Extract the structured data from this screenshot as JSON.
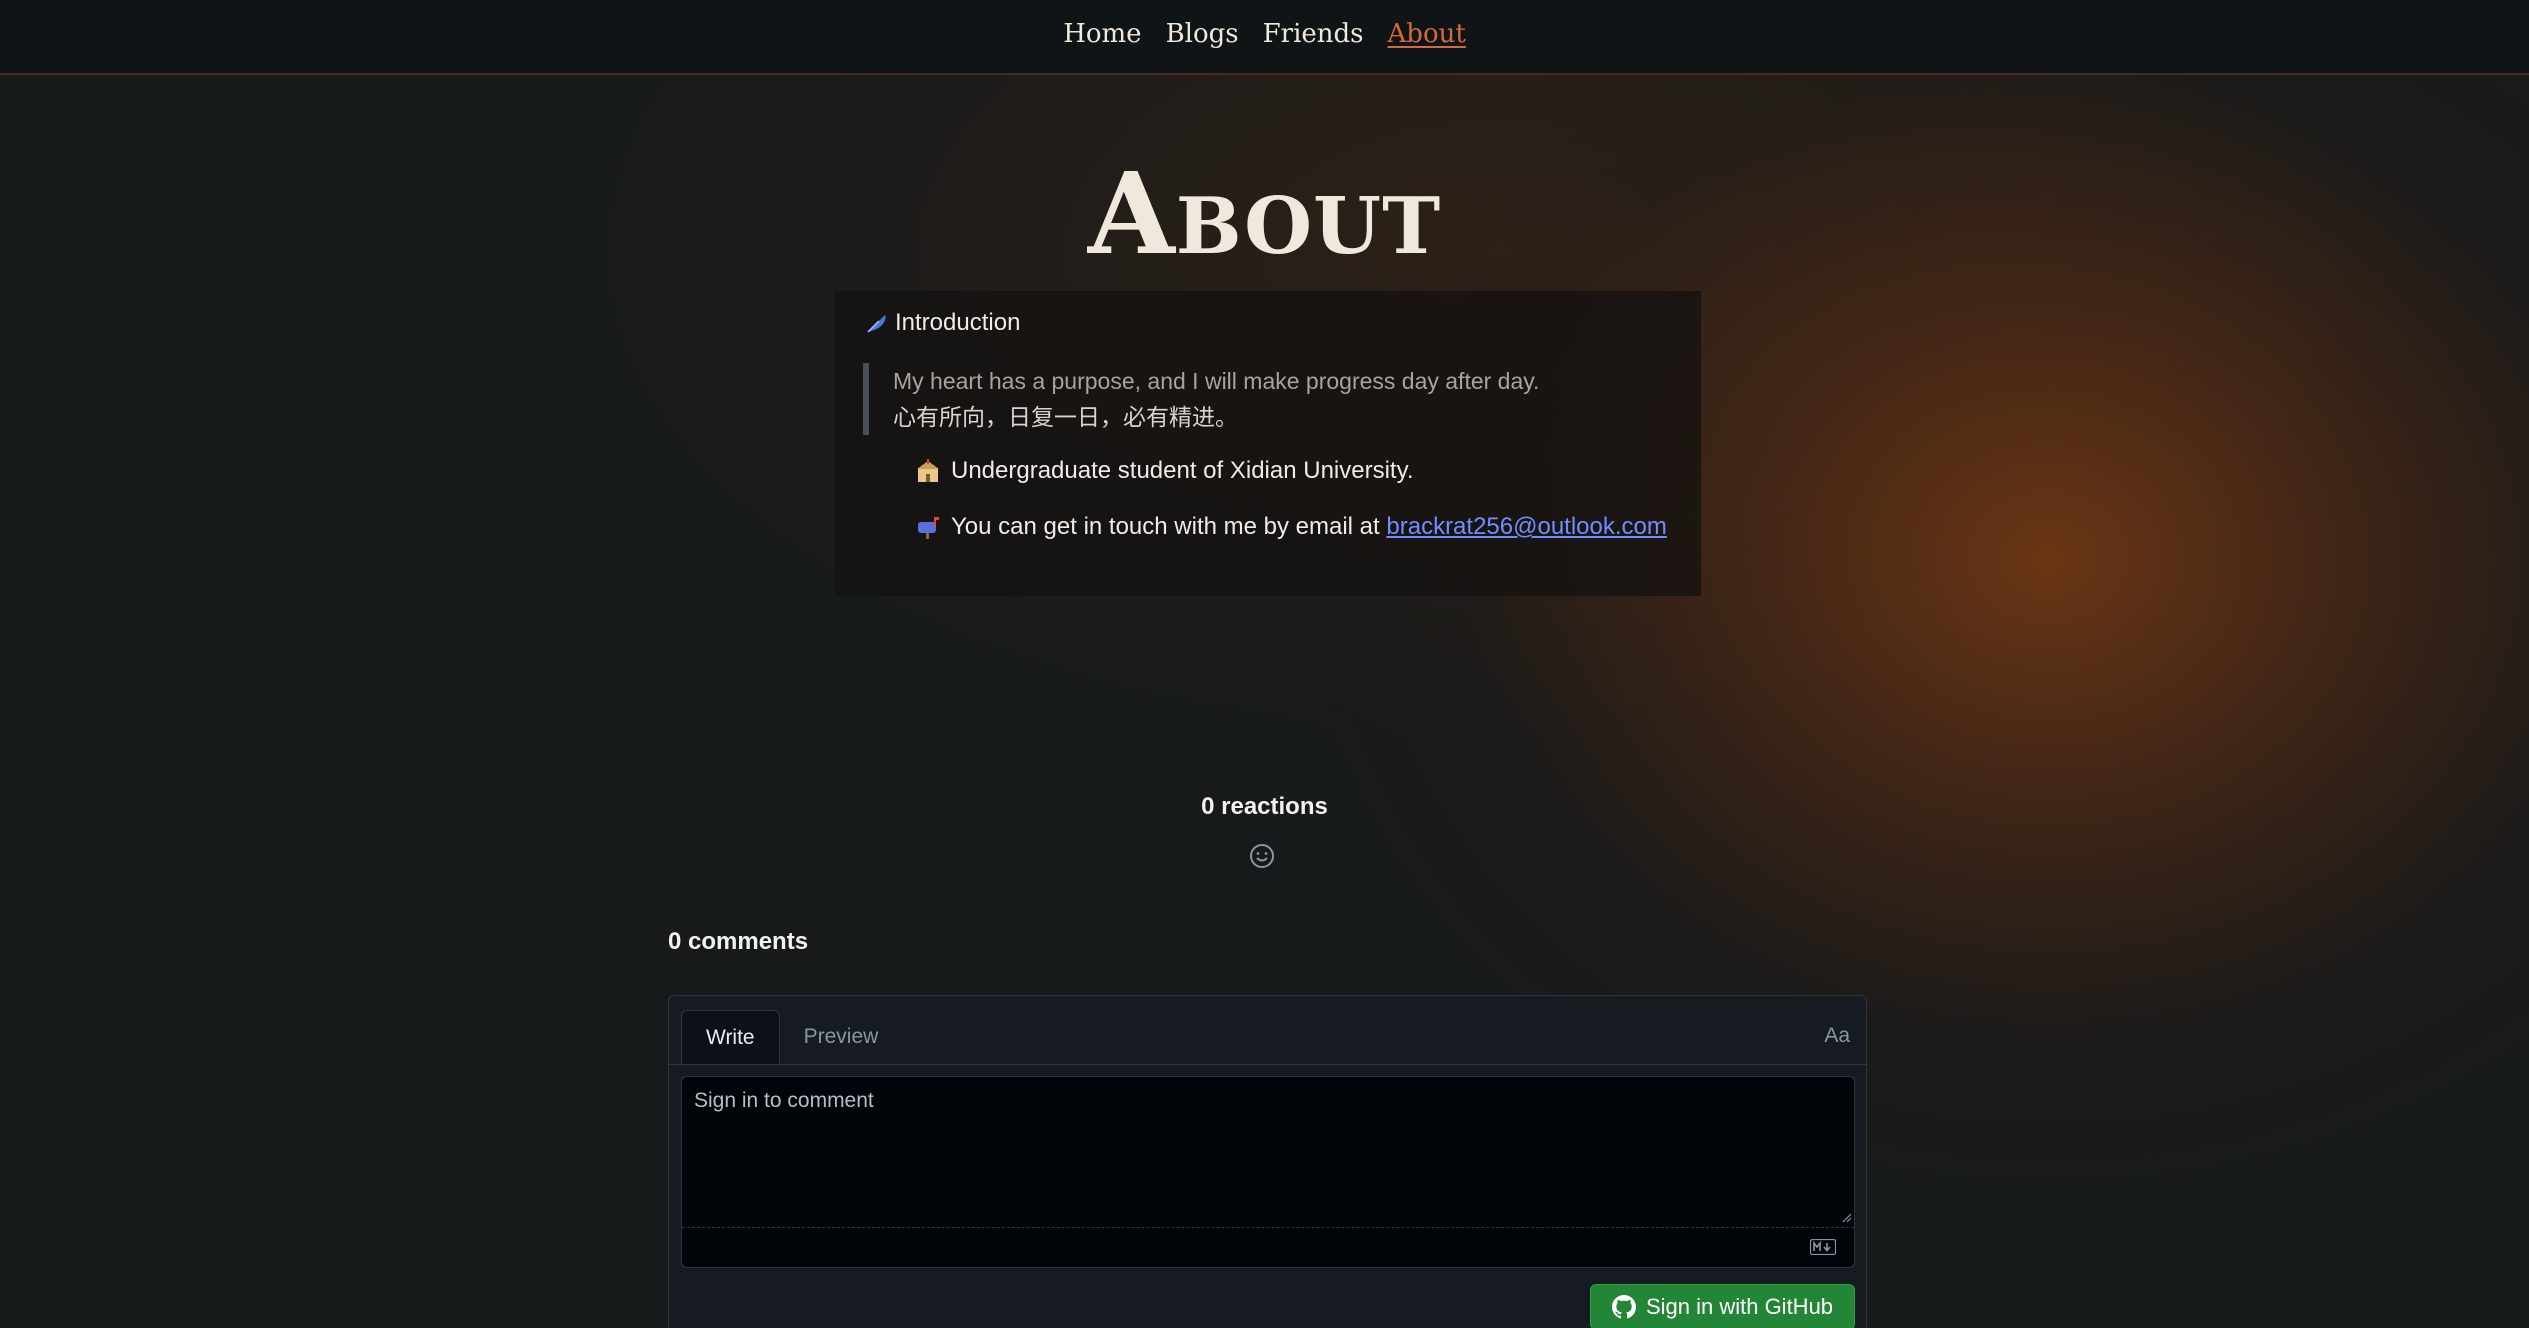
{
  "nav": {
    "items": [
      "Home",
      "Blogs",
      "Friends",
      "About"
    ],
    "active": "About"
  },
  "page": {
    "title": "About"
  },
  "intro": {
    "heading": "Introduction",
    "quote_en": "My heart has a purpose, and I will make progress day after day.",
    "quote_cn": "心有所向，日复一日，必有精进。",
    "item1": "Undergraduate student of Xidian University.",
    "item2_prefix": "You can get in touch with me by email at ",
    "email": "brackrat256@outlook.com"
  },
  "reactions": {
    "label": "0 reactions"
  },
  "comments": {
    "heading": "0 comments",
    "tab_write": "Write",
    "tab_preview": "Preview",
    "format_toggle": "Aa",
    "placeholder": "Sign in to comment",
    "signin_button": "Sign in with GitHub"
  },
  "colors": {
    "accent": "#d46a3a",
    "link": "#6f8fff",
    "github_green": "#238636"
  }
}
